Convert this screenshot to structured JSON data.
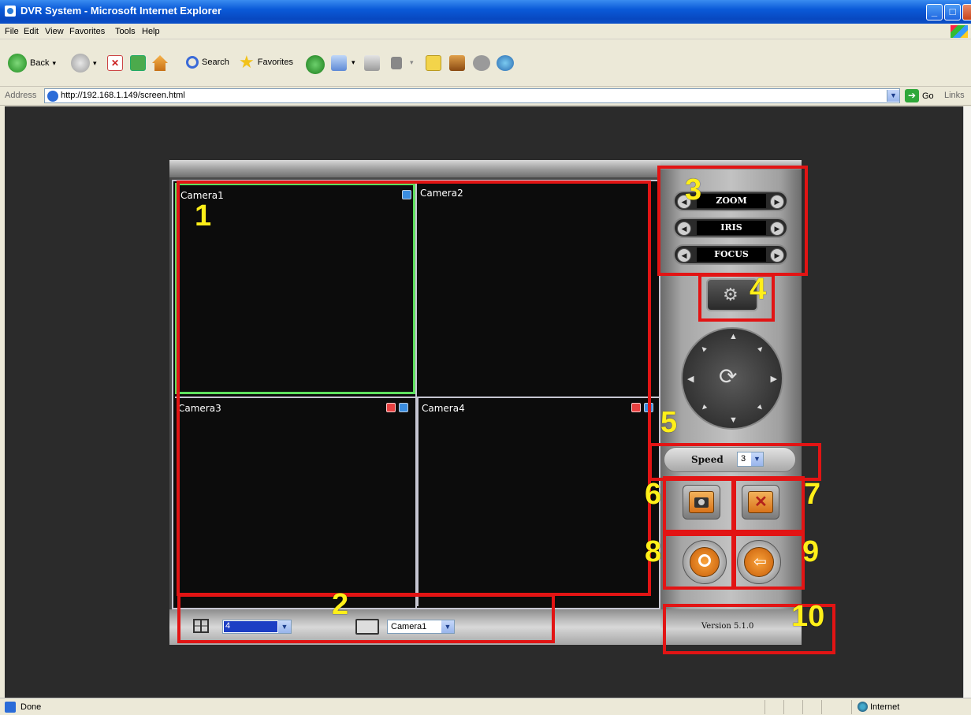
{
  "window": {
    "title": "DVR System - Microsoft Internet Explorer",
    "buttons": {
      "minimize": "_",
      "maximize": "□",
      "close": "X"
    }
  },
  "menu": [
    "File",
    "Edit",
    "View",
    "Favorites",
    "Tools",
    "Help"
  ],
  "toolbar": {
    "back": "Back",
    "search": "Search",
    "favorites": "Favorites"
  },
  "address": {
    "label": "Address",
    "url": "http://192.168.1.149/screen.html",
    "go": "Go",
    "links": "Links"
  },
  "status": {
    "text": "Done",
    "zone": "Internet"
  },
  "dvr": {
    "cameras": [
      {
        "label": "Camera1",
        "selected": true
      },
      {
        "label": "Camera2",
        "selected": false
      },
      {
        "label": "Camera3",
        "selected": false
      },
      {
        "label": "Camera4",
        "selected": false
      }
    ],
    "layout_value": "4",
    "camera_select_value": "Camera1",
    "ptz": {
      "zoom": "ZOOM",
      "iris": "IRIS",
      "focus": "FOCUS"
    },
    "speed_label": "Speed",
    "speed_value": "3",
    "version": "Version 5.1.0"
  },
  "annotations": [
    "1",
    "2",
    "3",
    "4",
    "5",
    "6",
    "7",
    "8",
    "9",
    "10"
  ],
  "colors": {
    "highlight": "#e21414",
    "annotation_text": "#ffef19",
    "selected_camera_border": "#5ee05e",
    "titlebar": "#0a5ad8"
  }
}
